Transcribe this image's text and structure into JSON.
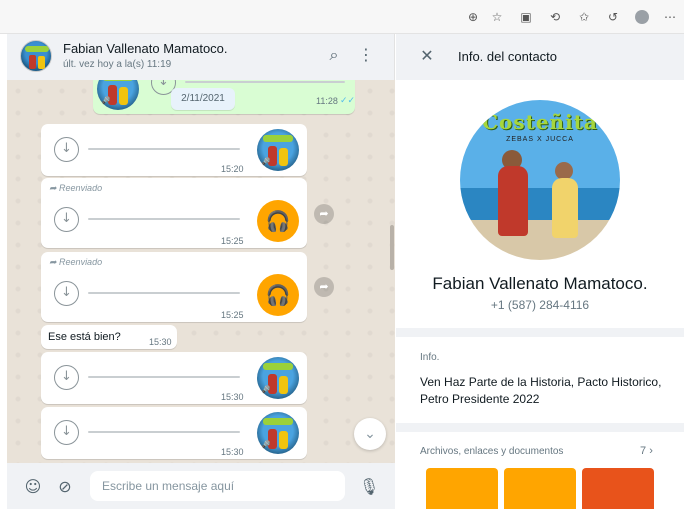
{
  "browser": {
    "icons": [
      "zoom-icon",
      "favorite-star-icon",
      "reading-mode-icon",
      "extensions-icon",
      "favorites-icon",
      "history-icon",
      "profile-icon",
      "more-icon"
    ]
  },
  "chat": {
    "contact_name": "Fabian Vallenato Mamatoco.",
    "last_seen": "últ. vez hoy a la(s) 11:19",
    "date_chip": "2/11/2021",
    "messages": [
      {
        "time": "11:28",
        "type": "audio-out"
      },
      {
        "time": "15:20",
        "type": "audio-in"
      },
      {
        "time": "15:25",
        "type": "audio-forwarded",
        "forwarded_label": "Reenviado"
      },
      {
        "time": "15:25",
        "type": "audio-forwarded",
        "forwarded_label": "Reenviado"
      },
      {
        "time": "15:30",
        "type": "text",
        "text": "Ese está bien?"
      },
      {
        "time": "15:30",
        "type": "audio-in"
      },
      {
        "time": "15:30",
        "type": "audio-in"
      }
    ],
    "input_placeholder": "Escribe un mensaje aquí"
  },
  "info": {
    "header_title": "Info. del contacto",
    "profile_name": "Fabian Vallenato Mamatoco.",
    "phone": "+1 (587) 284-4116",
    "about_label": "Info.",
    "about_text": "Ven Haz Parte de la Historia, Pacto Historico, Petro Presidente 2022",
    "media_label": "Archivos, enlaces y documentos",
    "media_count": "7",
    "avatar_logo": "Costeñita",
    "avatar_sub": "ZEBAS X JUCCA"
  },
  "colors": {
    "accent_orange": "#ffa500",
    "outgoing_bubble": "#d9fdd3",
    "read_ticks": "#53bdeb"
  }
}
